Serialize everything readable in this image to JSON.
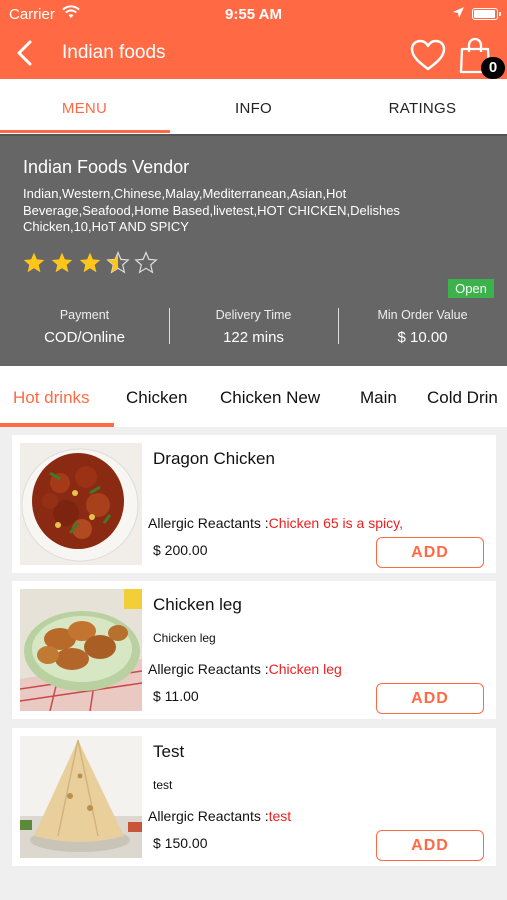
{
  "status": {
    "carrier": "Carrier",
    "time": "9:55 AM"
  },
  "header": {
    "title": "Indian foods",
    "cart_count": "0"
  },
  "tabs": [
    {
      "label": "MENU",
      "active": true
    },
    {
      "label": "INFO",
      "active": false
    },
    {
      "label": "RATINGS",
      "active": false
    }
  ],
  "vendor": {
    "name": "Indian Foods Vendor",
    "cuisines": "Indian,Western,Chinese,Malay,Mediterranean,Asian,Hot Beverage,Seafood,Home Based,livetest,HOT CHICKEN,Delishes Chicken,10,HoT AND SPICY",
    "rating": 3.5,
    "rating_max": 5,
    "status": "Open",
    "payment_label": "Payment",
    "payment_value": "COD/Online",
    "delivery_label": "Delivery Time",
    "delivery_value": "122 mins",
    "min_order_label": "Min Order Value",
    "min_order_value": "$ 10.00"
  },
  "categories": [
    {
      "label": "Hot drinks",
      "active": true
    },
    {
      "label": "Chicken",
      "active": false
    },
    {
      "label": "Chicken New",
      "active": false
    },
    {
      "label": "Main",
      "active": false
    },
    {
      "label": "Cold Drin",
      "active": false
    }
  ],
  "items": [
    {
      "name": "Dragon Chicken",
      "description": "",
      "allergy_label": "Allergic Reactants :",
      "allergy_value": "Chicken 65 is a spicy,",
      "price": "$ 200.00",
      "add_label": "ADD"
    },
    {
      "name": "Chicken leg",
      "description": "Chicken leg",
      "allergy_label": "Allergic Reactants :",
      "allergy_value": "Chicken leg",
      "price": "$ 11.00",
      "add_label": "ADD"
    },
    {
      "name": "Test",
      "description": "test",
      "allergy_label": "Allergic Reactants :",
      "allergy_value": "test",
      "price": "$ 150.00",
      "add_label": "ADD"
    }
  ],
  "colors": {
    "accent": "#ff6a45",
    "open_green": "#3cb34a",
    "allergy_red": "#ee2020",
    "vendor_bg": "#666666"
  },
  "icons": [
    "back-chevron-icon",
    "heart-icon",
    "shopping-bag-icon",
    "wifi-icon",
    "location-arrow-icon",
    "battery-icon",
    "star-icon"
  ]
}
